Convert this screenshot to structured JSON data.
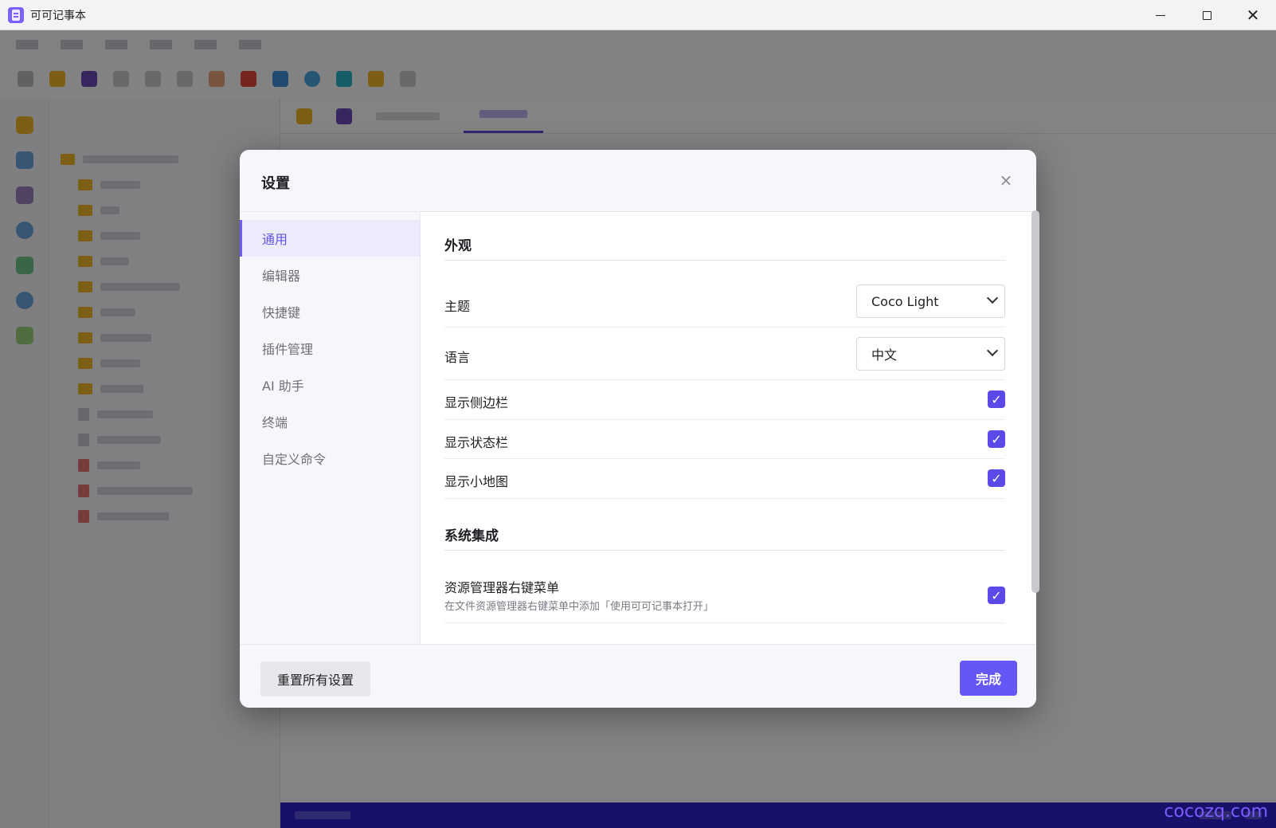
{
  "window": {
    "title": "可可记事本"
  },
  "dialog": {
    "title": "设置",
    "close_label": "×",
    "nav": [
      {
        "label": "通用",
        "active": true
      },
      {
        "label": "编辑器"
      },
      {
        "label": "快捷键"
      },
      {
        "label": "插件管理"
      },
      {
        "label": "AI 助手"
      },
      {
        "label": "终端"
      },
      {
        "label": "自定义命令"
      }
    ],
    "sections": {
      "appearance": {
        "title": "外观",
        "theme": {
          "label": "主题",
          "value": "Coco Light"
        },
        "language": {
          "label": "语言",
          "value": "中文"
        },
        "show_sidebar": {
          "label": "显示侧边栏",
          "checked": true
        },
        "show_statusbar": {
          "label": "显示状态栏",
          "checked": true
        },
        "show_minimap": {
          "label": "显示小地图",
          "checked": true
        }
      },
      "system": {
        "title": "系统集成",
        "context_menu": {
          "label": "资源管理器右键菜单",
          "description": "在文件资源管理器右键菜单中添加「使用可可记事本打开」",
          "checked": true
        }
      }
    },
    "footer": {
      "reset_label": "重置所有设置",
      "done_label": "完成"
    },
    "check_mark": "✓"
  },
  "watermark": "cocozq.com",
  "colors": {
    "accent": "#6557f5",
    "checkbox": "#5b49e8",
    "nav_active_bg": "#ecebfb",
    "statusbar": "#2e21c9"
  }
}
